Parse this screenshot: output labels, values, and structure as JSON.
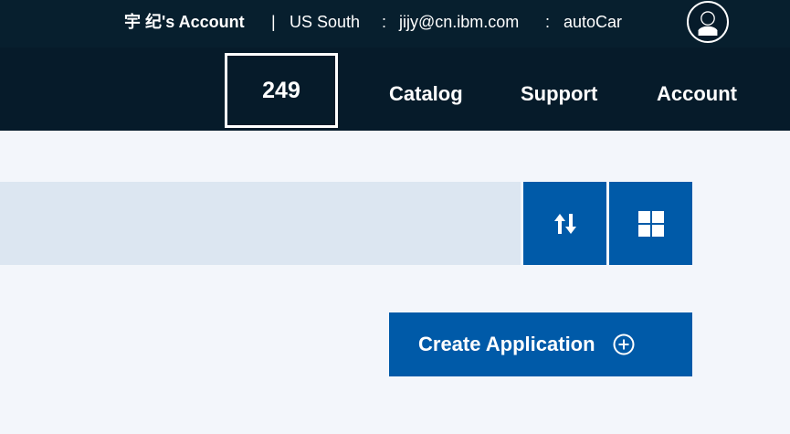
{
  "header": {
    "account_name": "宇 纪's Account",
    "separator_1": "|",
    "region": "US South",
    "separator_2": ":",
    "email": "jijy@cn.ibm.com",
    "separator_3": ":",
    "organization": "autoCar",
    "avatar_icon": "user-avatar-icon"
  },
  "navigation": {
    "counter": "249",
    "items": [
      {
        "label": "Catalog"
      },
      {
        "label": "Support"
      },
      {
        "label": "Account"
      }
    ]
  },
  "toolbar": {
    "search_placeholder": "",
    "sort_icon": "sort-arrows-icon",
    "grid_icon": "grid-view-icon"
  },
  "actions": {
    "create_application_label": "Create Application",
    "create_icon": "plus-circle-icon"
  },
  "colors": {
    "header_background": "#061b2a",
    "page_background": "#f3f6fb",
    "search_background": "#dce6f1",
    "accent": "#005aa8",
    "text_on_dark": "#ffffff"
  }
}
